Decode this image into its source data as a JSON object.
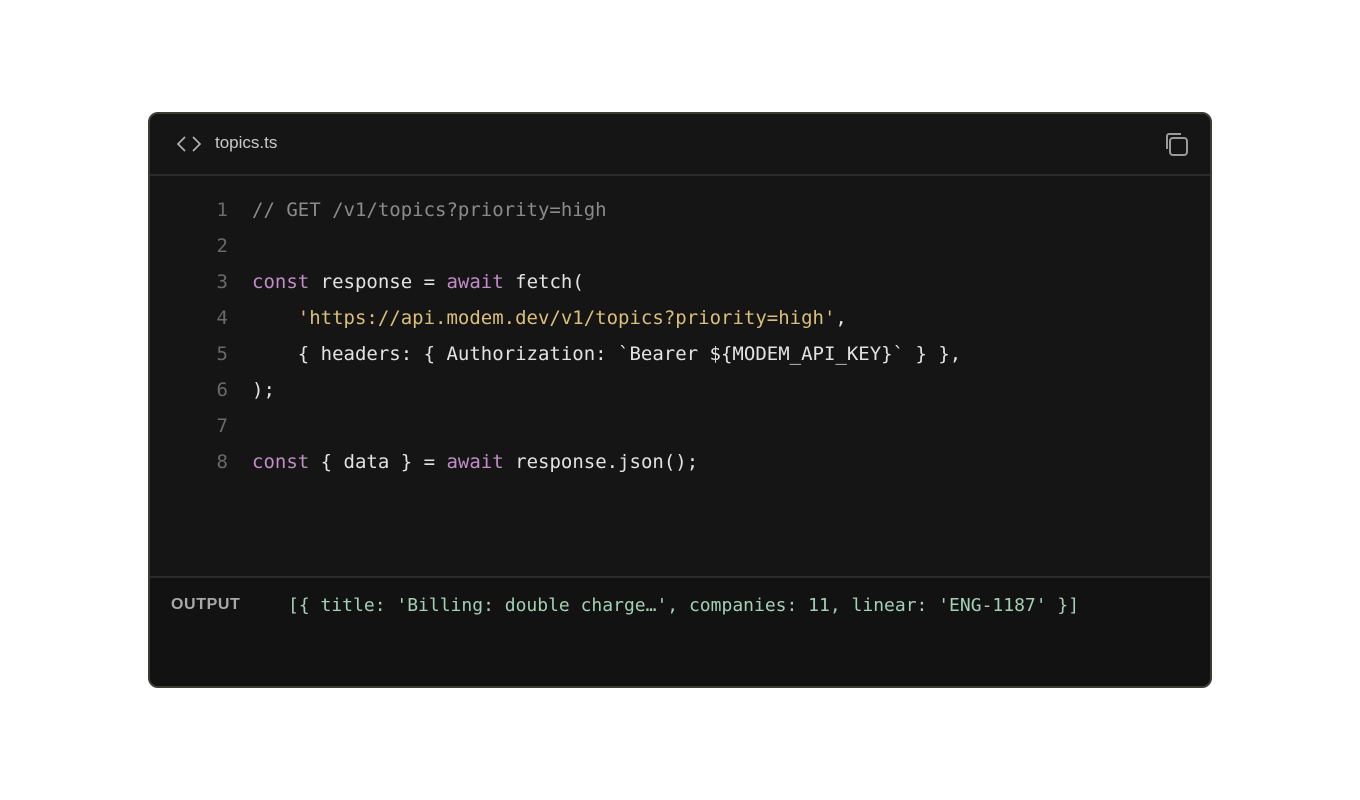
{
  "header": {
    "filename": "topics.ts",
    "file_icon": "code-brackets-icon",
    "copy_icon": "copy-icon"
  },
  "code": {
    "lines": [
      {
        "number": "1",
        "tokens": [
          {
            "type": "comment",
            "text": "// GET /v1/topics?priority=high"
          }
        ]
      },
      {
        "number": "2",
        "tokens": []
      },
      {
        "number": "3",
        "tokens": [
          {
            "type": "kw",
            "text": "const"
          },
          {
            "type": "plain",
            "text": " response = "
          },
          {
            "type": "kw",
            "text": "await"
          },
          {
            "type": "plain",
            "text": " fetch("
          }
        ]
      },
      {
        "number": "4",
        "tokens": [
          {
            "type": "plain",
            "text": "    "
          },
          {
            "type": "str",
            "text": "'https://api.modem.dev/v1/topics?priority=high'"
          },
          {
            "type": "plain",
            "text": ","
          }
        ]
      },
      {
        "number": "5",
        "tokens": [
          {
            "type": "plain",
            "text": "    { headers: { Authorization: `Bearer ${MODEM_API_KEY}` } },"
          }
        ]
      },
      {
        "number": "6",
        "tokens": [
          {
            "type": "plain",
            "text": ");"
          }
        ]
      },
      {
        "number": "7",
        "tokens": []
      },
      {
        "number": "8",
        "tokens": [
          {
            "type": "kw",
            "text": "const"
          },
          {
            "type": "plain",
            "text": " { data } = "
          },
          {
            "type": "kw",
            "text": "await"
          },
          {
            "type": "plain",
            "text": " response.json();"
          }
        ]
      }
    ]
  },
  "output": {
    "label": "OUTPUT",
    "value": "[{ title: 'Billing: double charge…', companies: 11, linear: 'ENG-1187' }]"
  },
  "colors": {
    "background": "#151515",
    "border": "#3d3c32",
    "comment": "#8b8b8b",
    "keyword": "#c38bc9",
    "string": "#dcbf78",
    "output_text": "#a3d1b2"
  }
}
